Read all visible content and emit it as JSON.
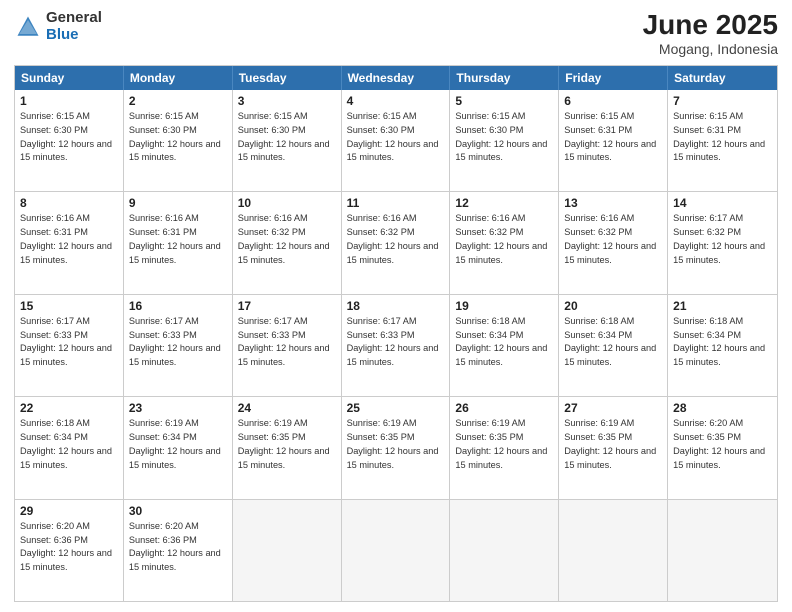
{
  "logo": {
    "general": "General",
    "blue": "Blue"
  },
  "title": "June 2025",
  "location": "Mogang, Indonesia",
  "days": [
    "Sunday",
    "Monday",
    "Tuesday",
    "Wednesday",
    "Thursday",
    "Friday",
    "Saturday"
  ],
  "weeks": [
    [
      {
        "day": "1",
        "sunrise": "6:15 AM",
        "sunset": "6:30 PM",
        "daylight": "12 hours and 15 minutes."
      },
      {
        "day": "2",
        "sunrise": "6:15 AM",
        "sunset": "6:30 PM",
        "daylight": "12 hours and 15 minutes."
      },
      {
        "day": "3",
        "sunrise": "6:15 AM",
        "sunset": "6:30 PM",
        "daylight": "12 hours and 15 minutes."
      },
      {
        "day": "4",
        "sunrise": "6:15 AM",
        "sunset": "6:30 PM",
        "daylight": "12 hours and 15 minutes."
      },
      {
        "day": "5",
        "sunrise": "6:15 AM",
        "sunset": "6:30 PM",
        "daylight": "12 hours and 15 minutes."
      },
      {
        "day": "6",
        "sunrise": "6:15 AM",
        "sunset": "6:31 PM",
        "daylight": "12 hours and 15 minutes."
      },
      {
        "day": "7",
        "sunrise": "6:15 AM",
        "sunset": "6:31 PM",
        "daylight": "12 hours and 15 minutes."
      }
    ],
    [
      {
        "day": "8",
        "sunrise": "6:16 AM",
        "sunset": "6:31 PM",
        "daylight": "12 hours and 15 minutes."
      },
      {
        "day": "9",
        "sunrise": "6:16 AM",
        "sunset": "6:31 PM",
        "daylight": "12 hours and 15 minutes."
      },
      {
        "day": "10",
        "sunrise": "6:16 AM",
        "sunset": "6:32 PM",
        "daylight": "12 hours and 15 minutes."
      },
      {
        "day": "11",
        "sunrise": "6:16 AM",
        "sunset": "6:32 PM",
        "daylight": "12 hours and 15 minutes."
      },
      {
        "day": "12",
        "sunrise": "6:16 AM",
        "sunset": "6:32 PM",
        "daylight": "12 hours and 15 minutes."
      },
      {
        "day": "13",
        "sunrise": "6:16 AM",
        "sunset": "6:32 PM",
        "daylight": "12 hours and 15 minutes."
      },
      {
        "day": "14",
        "sunrise": "6:17 AM",
        "sunset": "6:32 PM",
        "daylight": "12 hours and 15 minutes."
      }
    ],
    [
      {
        "day": "15",
        "sunrise": "6:17 AM",
        "sunset": "6:33 PM",
        "daylight": "12 hours and 15 minutes."
      },
      {
        "day": "16",
        "sunrise": "6:17 AM",
        "sunset": "6:33 PM",
        "daylight": "12 hours and 15 minutes."
      },
      {
        "day": "17",
        "sunrise": "6:17 AM",
        "sunset": "6:33 PM",
        "daylight": "12 hours and 15 minutes."
      },
      {
        "day": "18",
        "sunrise": "6:17 AM",
        "sunset": "6:33 PM",
        "daylight": "12 hours and 15 minutes."
      },
      {
        "day": "19",
        "sunrise": "6:18 AM",
        "sunset": "6:34 PM",
        "daylight": "12 hours and 15 minutes."
      },
      {
        "day": "20",
        "sunrise": "6:18 AM",
        "sunset": "6:34 PM",
        "daylight": "12 hours and 15 minutes."
      },
      {
        "day": "21",
        "sunrise": "6:18 AM",
        "sunset": "6:34 PM",
        "daylight": "12 hours and 15 minutes."
      }
    ],
    [
      {
        "day": "22",
        "sunrise": "6:18 AM",
        "sunset": "6:34 PM",
        "daylight": "12 hours and 15 minutes."
      },
      {
        "day": "23",
        "sunrise": "6:19 AM",
        "sunset": "6:34 PM",
        "daylight": "12 hours and 15 minutes."
      },
      {
        "day": "24",
        "sunrise": "6:19 AM",
        "sunset": "6:35 PM",
        "daylight": "12 hours and 15 minutes."
      },
      {
        "day": "25",
        "sunrise": "6:19 AM",
        "sunset": "6:35 PM",
        "daylight": "12 hours and 15 minutes."
      },
      {
        "day": "26",
        "sunrise": "6:19 AM",
        "sunset": "6:35 PM",
        "daylight": "12 hours and 15 minutes."
      },
      {
        "day": "27",
        "sunrise": "6:19 AM",
        "sunset": "6:35 PM",
        "daylight": "12 hours and 15 minutes."
      },
      {
        "day": "28",
        "sunrise": "6:20 AM",
        "sunset": "6:35 PM",
        "daylight": "12 hours and 15 minutes."
      }
    ],
    [
      {
        "day": "29",
        "sunrise": "6:20 AM",
        "sunset": "6:36 PM",
        "daylight": "12 hours and 15 minutes."
      },
      {
        "day": "30",
        "sunrise": "6:20 AM",
        "sunset": "6:36 PM",
        "daylight": "12 hours and 15 minutes."
      },
      null,
      null,
      null,
      null,
      null
    ]
  ]
}
